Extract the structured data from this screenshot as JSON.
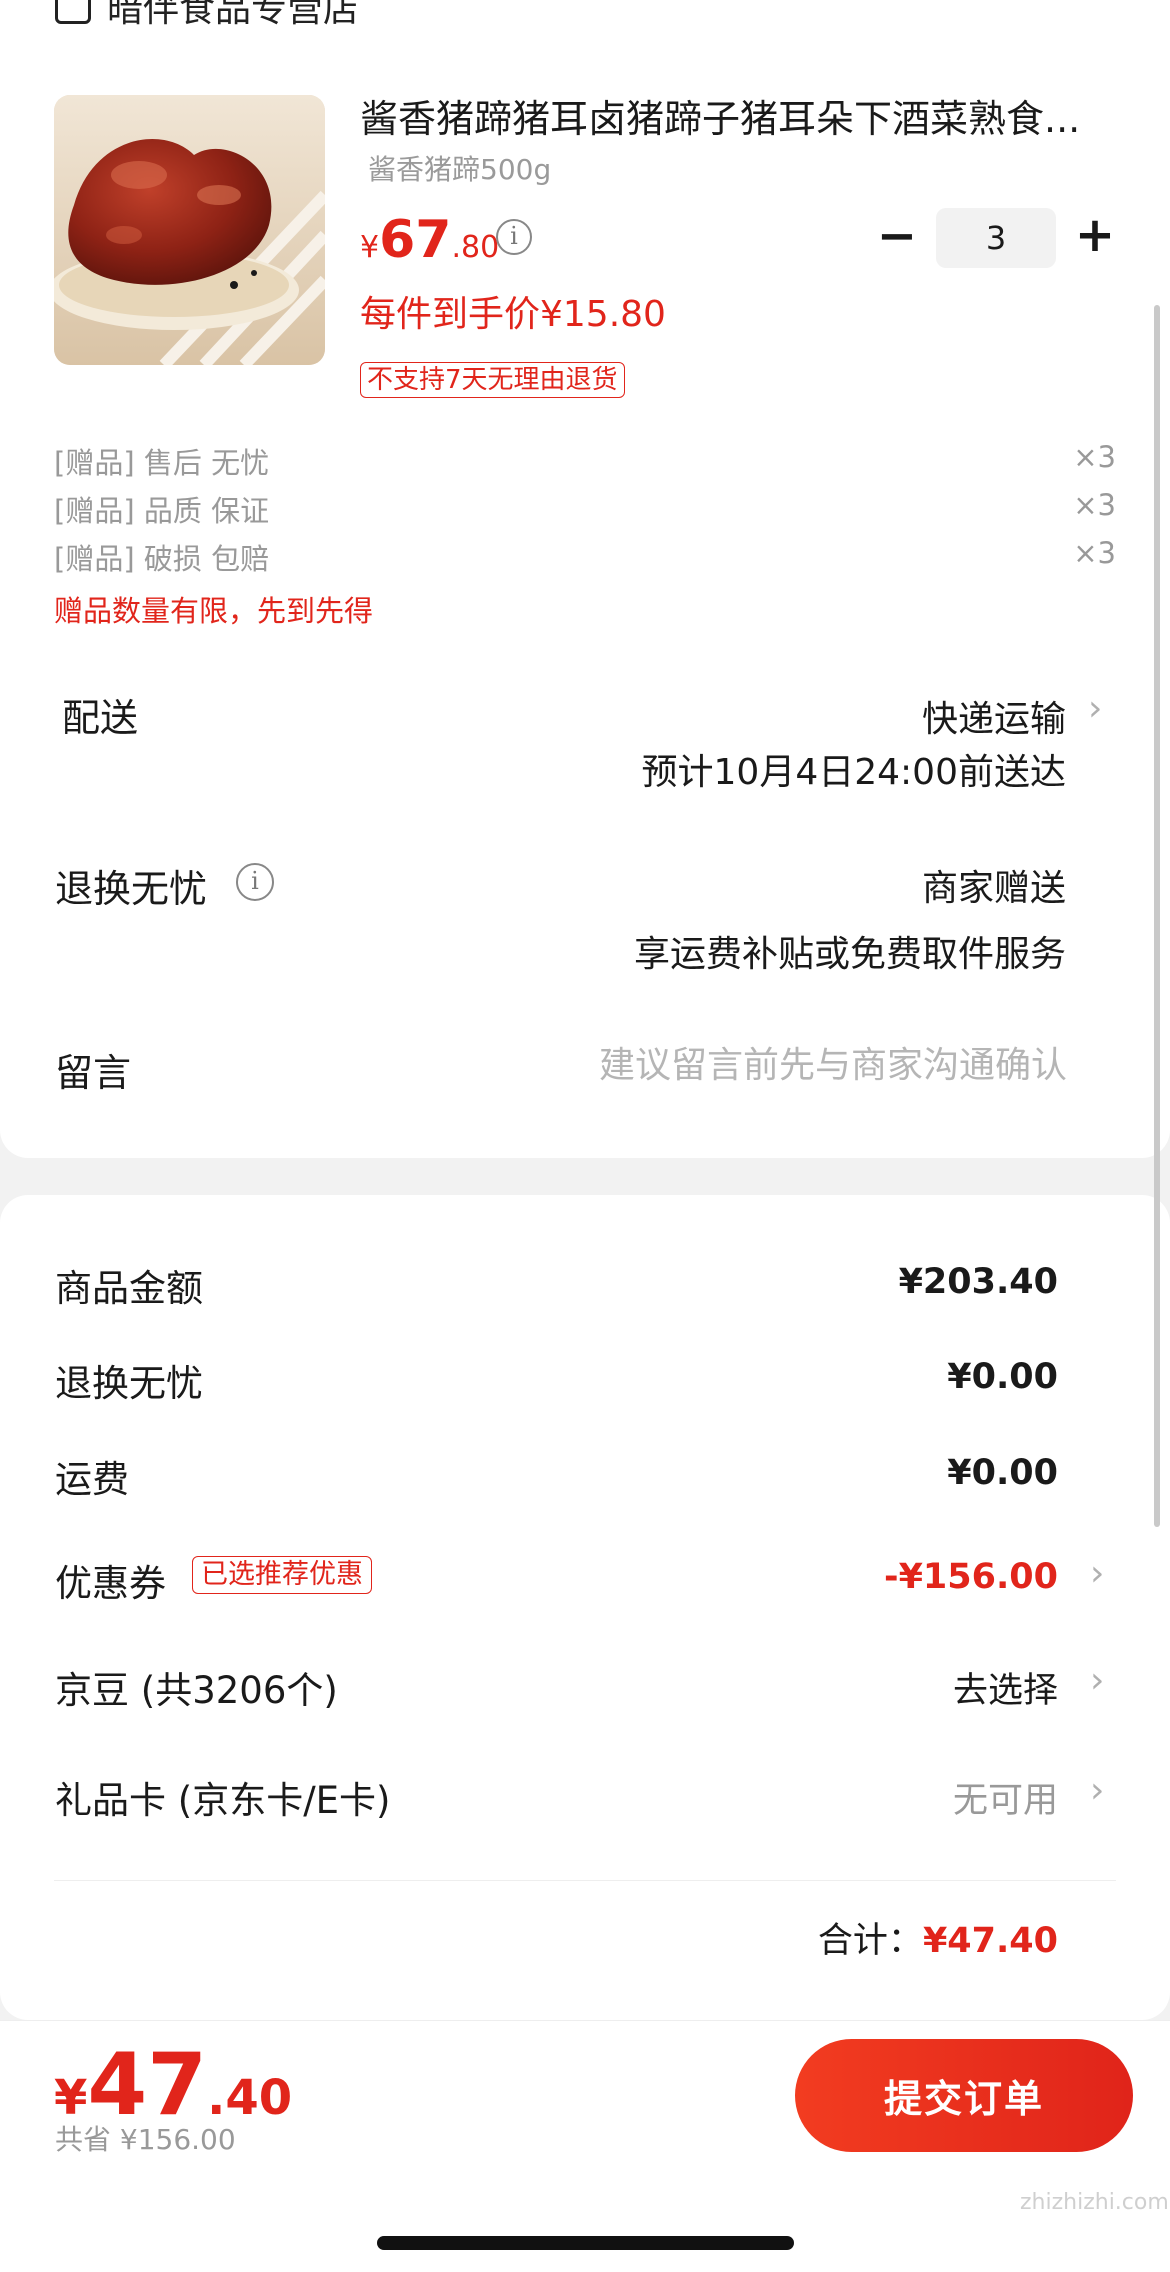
{
  "shop": {
    "name": "暗伴食品专营店"
  },
  "product": {
    "name": "酱香猪蹄猪耳卤猪蹄子猪耳朵下酒菜熟食...",
    "spec": "酱香猪蹄500g",
    "price_currency": "¥",
    "price_int": "67",
    "price_dec": ".80",
    "quantity": "3",
    "unit_price": "每件到手价¥15.80",
    "return_policy": "不支持7天无理由退货"
  },
  "gifts": [
    {
      "label": "[赠品] 售后 无忧",
      "qty": "×3"
    },
    {
      "label": "[赠品] 品质 保证",
      "qty": "×3"
    },
    {
      "label": "[赠品] 破损 包赔",
      "qty": "×3"
    }
  ],
  "gift_note": "赠品数量有限，先到先得",
  "shipping": {
    "label": "配送",
    "method": "快递运输",
    "eta": "预计10月4日24:00前送达"
  },
  "return_service": {
    "label": "退换无忧",
    "value": "商家赠送",
    "sub": "享运费补贴或免费取件服务"
  },
  "message": {
    "label": "留言",
    "placeholder": "建议留言前先与商家沟通确认"
  },
  "summary": {
    "goods_label": "商品金额",
    "goods_value": "¥203.40",
    "return_label": "退换无忧",
    "return_value": "¥0.00",
    "freight_label": "运费",
    "freight_value": "¥0.00",
    "coupon_label": "优惠券",
    "coupon_tag": "已选推荐优惠",
    "coupon_value": "-¥156.00",
    "beans_label": "京豆 (共3206个)",
    "beans_value": "去选择",
    "giftcard_label": "礼品卡 (京东卡/E卡)",
    "giftcard_value": "无可用",
    "total_label": "合计：",
    "total_value": "¥47.40"
  },
  "bottom": {
    "currency": "¥",
    "price_int": "47",
    "price_dec": ".40",
    "saved": "共省 ¥156.00",
    "submit": "提交订单"
  },
  "watermark": "zhizhizhi.com",
  "colors": {
    "accent": "#e1251b",
    "bg": "#f2f2f2"
  }
}
